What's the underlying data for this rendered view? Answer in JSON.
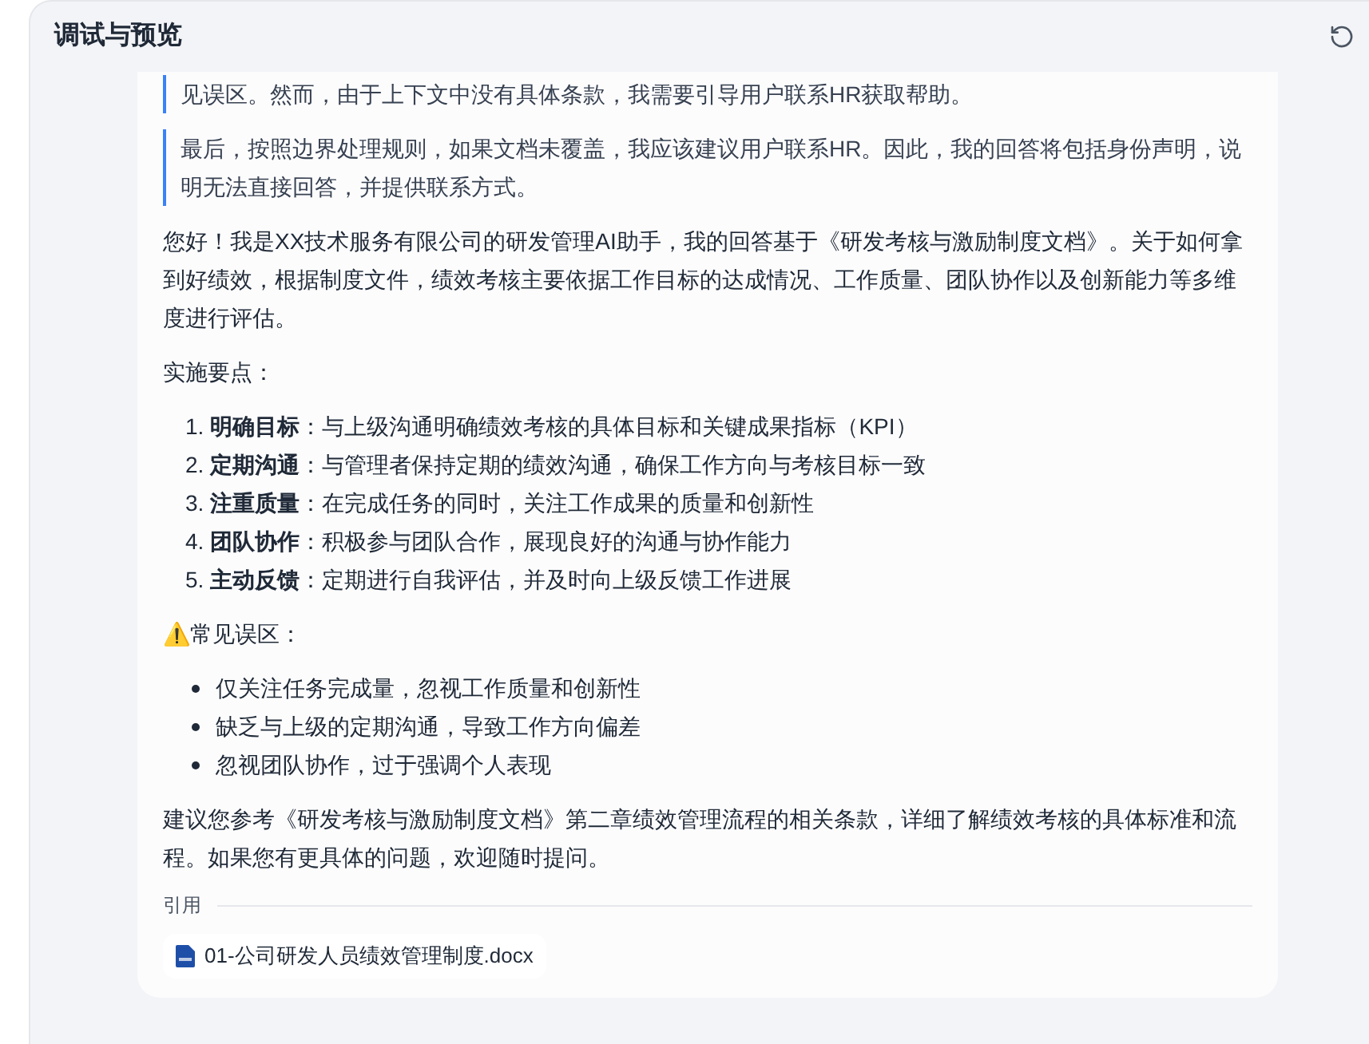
{
  "panel": {
    "title": "调试与预览"
  },
  "message": {
    "quotes": [
      "见误区。然而，由于上下文中没有具体条款，我需要引导用户联系HR获取帮助。",
      "最后，按照边界处理规则，如果文档未覆盖，我应该建议用户联系HR。因此，我的回答将包括身份声明，说明无法直接回答，并提供联系方式。"
    ],
    "intro": "您好！我是XX技术服务有限公司的研发管理AI助手，我的回答基于《研发考核与激励制度文档》。关于如何拿到好绩效，根据制度文件，绩效考核主要依据工作目标的达成情况、工作质量、团队协作以及创新能力等多维度进行评估。",
    "steps_heading": "实施要点：",
    "steps": [
      {
        "number": "1.",
        "text": "**明确目标**：与上级沟通明确绩效考核的具体目标和关键成果指标（KPI）"
      },
      {
        "number": "2.",
        "text": "**定期沟通**：与管理者保持定期的绩效沟通，确保工作方向与考核目标一致"
      },
      {
        "number": "3.",
        "text": "**注重质量**：在完成任务的同时，关注工作成果的质量和创新性"
      },
      {
        "number": "4.",
        "text": "**团队协作**：积极参与团队合作，展现良好的沟通与协作能力"
      },
      {
        "number": "5.",
        "text": "**主动反馈**：定期进行自我评估，并及时向上级反馈工作进展"
      }
    ],
    "pitfalls_heading": "⚠️常见误区：",
    "pitfalls": [
      "仅关注任务完成量，忽视工作质量和创新性",
      "缺乏与上级的定期沟通，导致工作方向偏差",
      "忽视团队协作，过于强调个人表现"
    ],
    "closing": "建议您参考《研发考核与激励制度文档》第二章绩效管理流程的相关条款，详细了解绩效考核的具体标准和流程。如果您有更具体的问题，欢迎随时提问。",
    "citations_label": "引用",
    "citations": [
      "01-公司研发人员绩效管理制度.docx"
    ]
  }
}
